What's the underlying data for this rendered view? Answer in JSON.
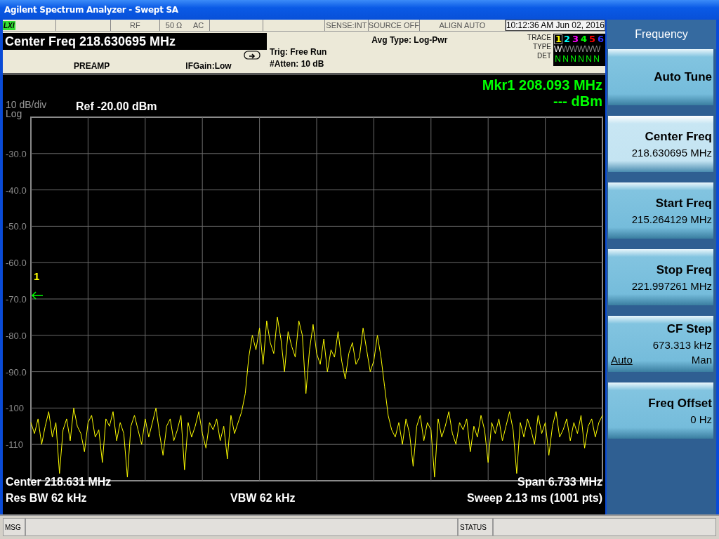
{
  "window": {
    "title": "Agilent Spectrum Analyzer - Swept SA"
  },
  "status_row": {
    "logo": "LXI",
    "cells": [
      {
        "kind": "blank",
        "text": ""
      },
      {
        "kind": "text",
        "text": "RF"
      },
      {
        "kind": "pair",
        "text": "50 Ω",
        "text2": "AC"
      },
      {
        "kind": "blank",
        "text": ""
      },
      {
        "kind": "blank",
        "text": ""
      },
      {
        "kind": "text",
        "text": "SENSE:INT"
      },
      {
        "kind": "text",
        "text": "SOURCE OFF"
      },
      {
        "kind": "text",
        "text": "ALIGN AUTO"
      },
      {
        "kind": "time",
        "text": "10:12:36 AM Jun 02, 2016"
      }
    ]
  },
  "header": {
    "active_function": "Center Freq  218.630695 MHz",
    "preamp": "PREAMP",
    "ifgain": "IFGain:Low",
    "trig": "Trig: Free Run",
    "atten": "#Atten: 10 dB",
    "avg_type": "Avg Type: Log-Pwr",
    "trace_labels": [
      "TRACE",
      "TYPE",
      "DET"
    ],
    "traces": [
      {
        "number": "1",
        "color": "#ffff00",
        "selected": true,
        "type": "W",
        "type_active": true,
        "det": "N"
      },
      {
        "number": "2",
        "color": "#00ffff",
        "selected": false,
        "type": "W",
        "type_active": false,
        "det": "N"
      },
      {
        "number": "3",
        "color": "#ff00ff",
        "selected": false,
        "type": "W",
        "type_active": false,
        "det": "N"
      },
      {
        "number": "4",
        "color": "#00ff00",
        "selected": false,
        "type": "W",
        "type_active": false,
        "det": "N"
      },
      {
        "number": "5",
        "color": "#ff0000",
        "selected": false,
        "type": "W",
        "type_active": false,
        "det": "N"
      },
      {
        "number": "6",
        "color": "#3333ff",
        "selected": false,
        "type": "W",
        "type_active": false,
        "det": "N"
      }
    ]
  },
  "display": {
    "marker_readout": "Mkr1 208.093 MHz",
    "marker_value": "--- dBm",
    "scale": "10 dB/div",
    "scale_type": "Log",
    "ref_level": "Ref -20.00 dBm",
    "marker_label": "1",
    "chart_data": {
      "type": "line",
      "grid": true,
      "ylim": [
        -120,
        -20
      ],
      "yticks": [
        {
          "value": -30,
          "label": "-30.0"
        },
        {
          "value": -40,
          "label": "-40.0"
        },
        {
          "value": -50,
          "label": "-50.0"
        },
        {
          "value": -60,
          "label": "-60.0"
        },
        {
          "value": -70,
          "label": "-70.0"
        },
        {
          "value": -80,
          "label": "-80.0"
        },
        {
          "value": -90,
          "label": "-90.0"
        },
        -100,
        -110
      ],
      "series": [
        {
          "color": "#ffff00",
          "values": [
            -104,
            -107,
            -103,
            -110,
            -105,
            -101,
            -108,
            -104,
            -118,
            -106,
            -103,
            -109,
            -100,
            -105,
            -107,
            -112,
            -104,
            -102,
            -108,
            -106,
            -115,
            -103,
            -105,
            -101,
            -109,
            -104,
            -107,
            -119,
            -105,
            -102,
            -106,
            -110,
            -103,
            -108,
            -104,
            -100,
            -107,
            -113,
            -105,
            -103,
            -109,
            -106,
            -102,
            -117,
            -104,
            -108,
            -105,
            -101,
            -107,
            -111,
            -104,
            -106,
            -103,
            -109,
            -105,
            -114,
            -102,
            -107,
            -104,
            -101,
            -96,
            -86,
            -80,
            -84,
            -78,
            -88,
            -76,
            -82,
            -85,
            -75,
            -81,
            -90,
            -79,
            -83,
            -86,
            -76,
            -80,
            -96,
            -84,
            -77,
            -85,
            -88,
            -81,
            -90,
            -84,
            -86,
            -79,
            -87,
            -92,
            -85,
            -82,
            -88,
            -86,
            -78,
            -84,
            -90,
            -87,
            -80,
            -86,
            -94,
            -102,
            -106,
            -108,
            -104,
            -110,
            -103,
            -107,
            -116,
            -105,
            -102,
            -109,
            -104,
            -106,
            -119,
            -103,
            -108,
            -105,
            -101,
            -107,
            -110,
            -104,
            -106,
            -103,
            -112,
            -105,
            -108,
            -102,
            -106,
            -115,
            -104,
            -107,
            -103,
            -109,
            -105,
            -101,
            -106,
            -118,
            -104,
            -108,
            -103,
            -106,
            -110,
            -102,
            -107,
            -104,
            -113,
            -105,
            -101,
            -108,
            -106,
            -103,
            -109,
            -104,
            -107,
            -102,
            -111,
            -105,
            -103,
            -108,
            -104,
            -102
          ]
        }
      ]
    },
    "center": "Center 218.631 MHz",
    "span": "Span 6.733 MHz",
    "res_bw": "Res BW 62 kHz",
    "vbw": "VBW 62 kHz",
    "sweep": "Sweep  2.13 ms (1001 pts)"
  },
  "softkeys": {
    "title": "Frequency",
    "keys": [
      {
        "kind": "plain",
        "label": "Auto Tune",
        "selected": false
      },
      {
        "kind": "value",
        "label": "Center Freq",
        "value": "218.630695 MHz",
        "selected": true
      },
      {
        "kind": "value",
        "label": "Start Freq",
        "value": "215.264129 MHz",
        "selected": false
      },
      {
        "kind": "value",
        "label": "Stop Freq",
        "value": "221.997261 MHz",
        "selected": false
      },
      {
        "kind": "toggle",
        "label": "CF Step",
        "value": "673.313 kHz",
        "selected": false,
        "options": [
          {
            "label": "Auto",
            "selected": true
          },
          {
            "label": "Man",
            "selected": false
          }
        ]
      },
      {
        "kind": "value",
        "label": "Freq Offset",
        "value": "0 Hz",
        "selected": false
      }
    ]
  },
  "status_bar": {
    "msg": "MSG",
    "status": "STATUS"
  }
}
